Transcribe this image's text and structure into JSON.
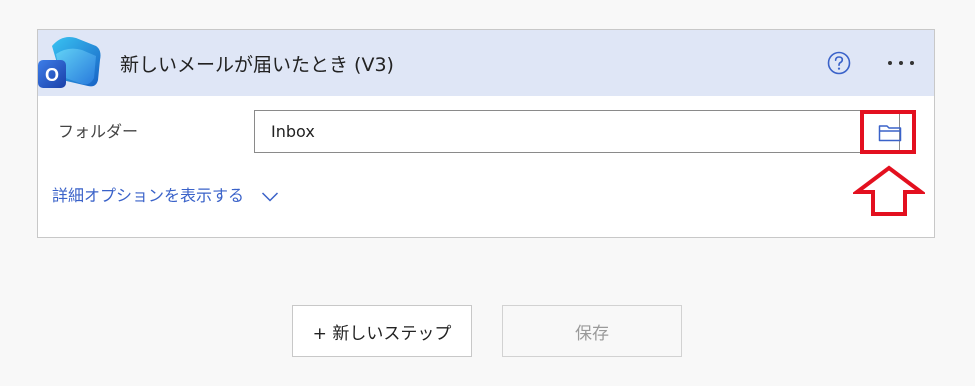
{
  "trigger": {
    "title": "新しいメールが届いたとき (V3)",
    "logo_letter": "O",
    "help_icon": "question-circle-icon",
    "more_icon": "ellipsis-icon"
  },
  "folder_field": {
    "label": "フォルダー",
    "value": "Inbox",
    "picker_icon": "folder-icon"
  },
  "advanced": {
    "label": "詳細オプションを表示する",
    "icon": "chevron-down-icon"
  },
  "footer": {
    "new_step_label": "+ 新しいステップ",
    "save_label": "保存"
  },
  "colors": {
    "header_bg": "#dfe6f6",
    "link": "#3a62c9",
    "highlight": "#e3101f"
  }
}
